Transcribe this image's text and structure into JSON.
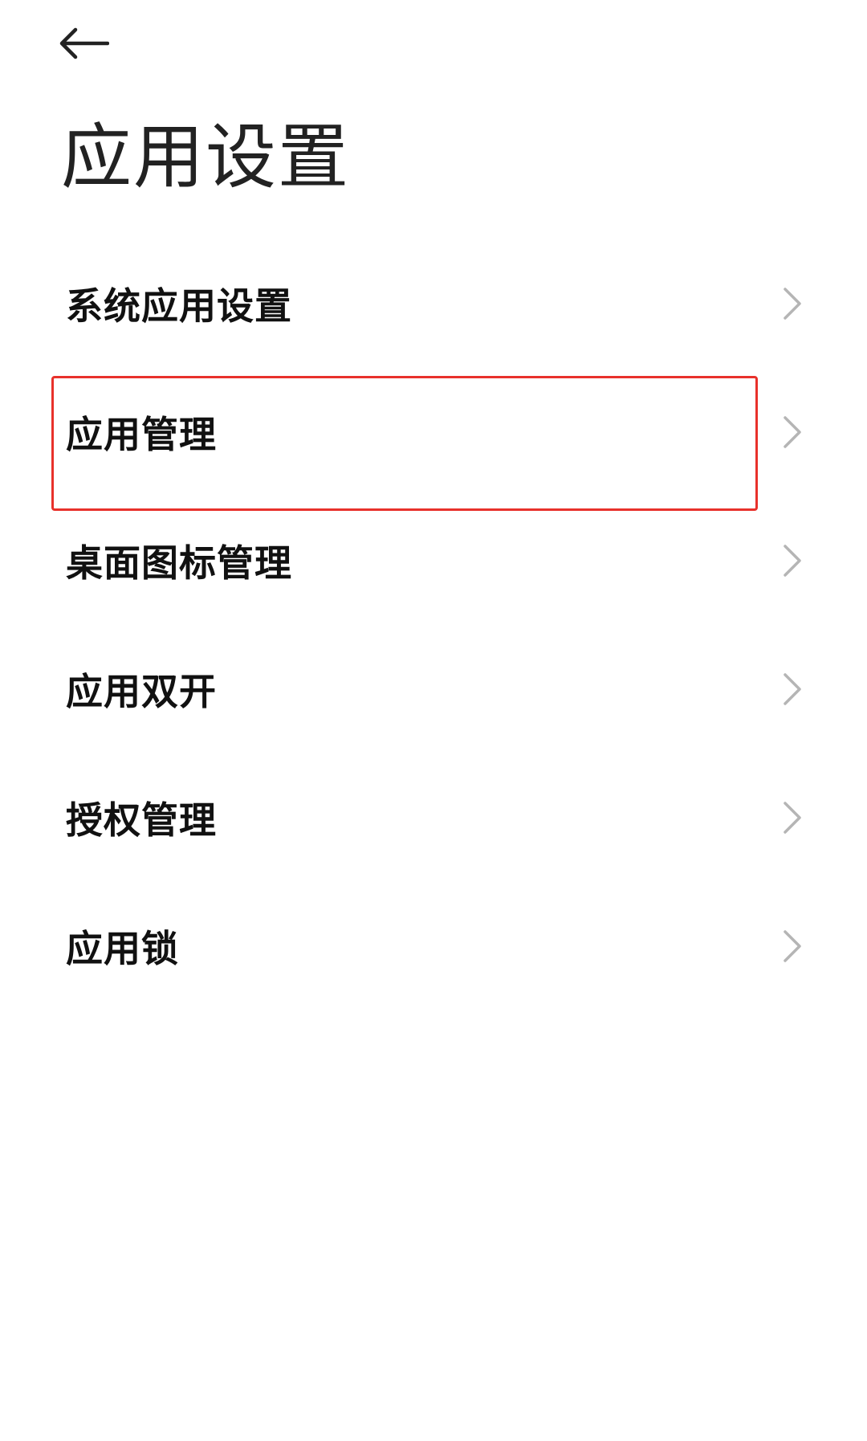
{
  "header": {
    "back_icon": "arrow-left-icon",
    "title": "应用设置"
  },
  "settings": {
    "items": [
      {
        "label": "系统应用设置",
        "icon": "chevron-right-icon"
      },
      {
        "label": "应用管理",
        "icon": "chevron-right-icon",
        "highlighted": true
      },
      {
        "label": "桌面图标管理",
        "icon": "chevron-right-icon"
      },
      {
        "label": "应用双开",
        "icon": "chevron-right-icon"
      },
      {
        "label": "授权管理",
        "icon": "chevron-right-icon"
      },
      {
        "label": "应用锁",
        "icon": "chevron-right-icon"
      }
    ]
  },
  "colors": {
    "background": "#ffffff",
    "text": "#111111",
    "title": "#222222",
    "chevron": "#b5b5b5",
    "highlight": "#e8312b"
  }
}
